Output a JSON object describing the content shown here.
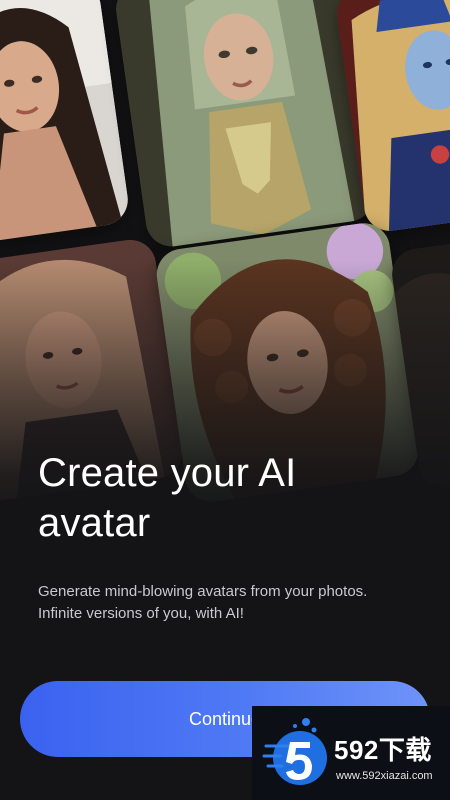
{
  "onboarding": {
    "headline": "Create your AI avatar",
    "description": "Generate mind-blowing avatars from your photos. Infinite versions of you, with AI!",
    "continue_label": "Continue"
  },
  "avatars": [
    {
      "name": "dark-haired-woman-portrait"
    },
    {
      "name": "elf-warrior-portrait"
    },
    {
      "name": "blue-fantasy-queen-portrait"
    },
    {
      "name": "blonde-woman-portrait"
    },
    {
      "name": "curly-haired-woman-portrait"
    },
    {
      "name": "dark-edge-portrait"
    }
  ],
  "watermark": {
    "brand": "592下载",
    "url": "www.592xiazai.com"
  },
  "colors": {
    "background": "#141416",
    "button_start": "#3a62f0",
    "button_end": "#6f93f8",
    "text_secondary": "#c9c9cf"
  }
}
